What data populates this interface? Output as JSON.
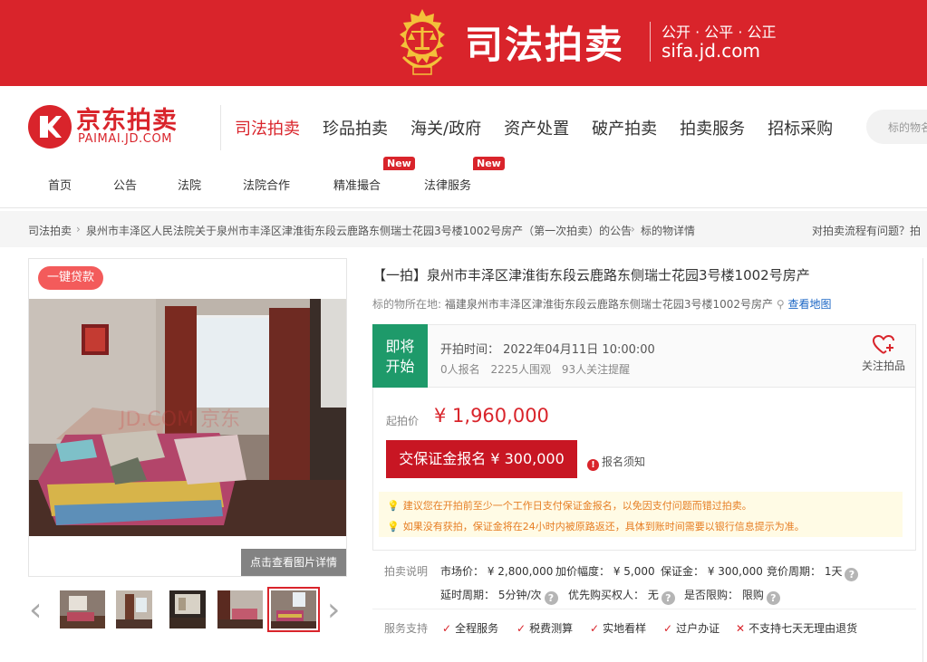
{
  "banner": {
    "title": "司法拍卖",
    "slogan": "公开 · 公平 · 公正",
    "domain": "sifa.jd.com"
  },
  "header": {
    "logo_cn": "京东拍卖",
    "logo_en": "PAIMAI.JD.COM",
    "main_nav": [
      "司法拍卖",
      "珍品拍卖",
      "海关/政府",
      "资产处置",
      "破产拍卖",
      "拍卖服务",
      "招标采购"
    ],
    "search_placeholder": "标的物名"
  },
  "sub_nav": {
    "items": [
      "首页",
      "公告",
      "法院",
      "法院合作",
      "精准撮合",
      "法律服务"
    ],
    "badge": "New"
  },
  "breadcrumb": {
    "items": [
      "司法拍卖",
      "泉州市丰泽区人民法院关于泉州市丰泽区津淮街东段云鹿路东侧瑞士花园3号楼1002号房产（第一次拍卖）的公告",
      "标的物详情"
    ],
    "help": "对拍卖流程有问题？拍"
  },
  "gallery": {
    "loan_tag": "一键贷款",
    "watermark": "JD.COM 京东",
    "detail_button": "点击查看图片详情",
    "selected_thumb": 5
  },
  "item": {
    "title": "【一拍】泉州市丰泽区津淮街东段云鹿路东侧瑞士花园3号楼1002号房产",
    "location_label": "标的物所在地:",
    "location": "福建泉州市丰泽区津淮街东段云鹿路东侧瑞士花园3号楼1002号房产",
    "map_link": "查看地图",
    "status_line1": "即将",
    "status_line2": "开始",
    "start_time": "开拍时间：  2022年04月11日  10:00:00",
    "signups": "0人报名",
    "views": "2225人围观",
    "followers": "93人关注提醒",
    "follow_label": "关注拍品",
    "start_price_label": "起拍价",
    "start_price": "¥ 1,960,000",
    "deposit_button": "交保证金报名 ¥ 300,000",
    "notice_link": "报名须知",
    "tip1": "建议您在开拍前至少一个工作日支付保证金报名，以免因支付问题而错过拍卖。",
    "tip2": "如果没有获拍，保证金将在24小时内被原路返还，具体到账时间需要以银行信息提示为准。"
  },
  "rules": {
    "label": "拍卖说明",
    "market_price": "市场价：  ¥ 2,800,000",
    "increment": "加价幅度：  ¥ 5,000",
    "deposit": "保证金：  ¥ 300,000",
    "period": "竞价周期：  1天",
    "extension": "延时周期：  5分钟/次",
    "priority": "优先购买权人：  无",
    "limit": "是否限购：  限购"
  },
  "service": {
    "label": "服务支持",
    "items": [
      "全程服务",
      "税费测算",
      "实地看样",
      "过户办证"
    ],
    "unsupported": "不支持七天无理由退货"
  },
  "colors": {
    "brand": "#d9242b",
    "status": "#1e9a6a",
    "link": "#1b66c5"
  }
}
